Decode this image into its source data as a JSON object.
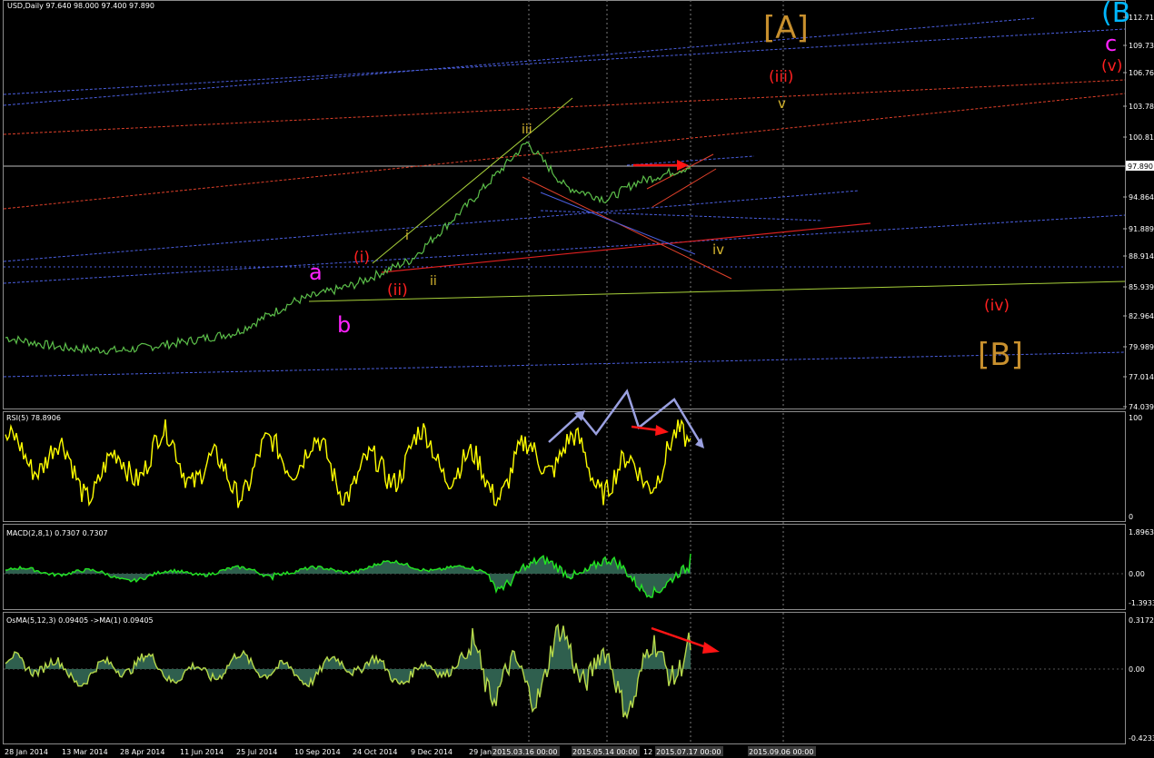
{
  "symbol_header": "USD,Daily  97.640 98.000 97.400 97.890",
  "colors": {
    "background": "#000000",
    "price_line": "#5cbf4a",
    "rsi_line": "#ffff00",
    "macd_line": "#22e622",
    "macd_fill": "#2f5f4e",
    "osma_line": "#b6d94a",
    "osma_fill": "#2f5f4e",
    "red_arrow": "#ff1414",
    "grey_arrow": "#9aa0e0"
  },
  "price_axis": {
    "ticks": [
      "112.71",
      "109.73",
      "106.76",
      "103.78",
      "100.81",
      "97.890",
      "94.864",
      "91.889",
      "88.914",
      "85.939",
      "82.964",
      "79.989",
      "77.014",
      "74.039"
    ],
    "current_price_label": "97.890"
  },
  "rsi_panel": {
    "label": "RSI(5) 78.8906",
    "ticks": [
      "100",
      "0"
    ]
  },
  "macd_panel": {
    "label": "MACD(2,8,1) 0.7307 0.7307",
    "ticks": [
      "1.8963",
      "0.00",
      "-1.3933"
    ]
  },
  "osma_panel": {
    "label": "OsMA(5,12,3) 0.09405  ->MA(1) 0.09405",
    "ticks": [
      "0.3172",
      "0.00",
      "-0.4233"
    ]
  },
  "date_axis": {
    "ticks": [
      "28 Jan 2014",
      "13 Mar 2014",
      "28 Apr 2014",
      "11 Jun 2014",
      "25 Jul 2014",
      "10 Sep 2014",
      "24 Oct 2014",
      "9 Dec 2014",
      "29 Jan"
    ],
    "highlighted": [
      "2015.03.16 00:00",
      "2015.05.14 00:00",
      "2015.07.17 00:00",
      "2015.09.06 00:00"
    ],
    "extra_ticks": [
      "12"
    ]
  },
  "wave_labels": [
    {
      "text": "[A]",
      "color": "#c8902e"
    },
    {
      "text": "[B]",
      "color": "#c8902e"
    },
    {
      "text": "(B",
      "color": "#00b7ff"
    },
    {
      "text": "c",
      "color": "#ff22ff"
    },
    {
      "text": "(v)",
      "color": "#ff2020"
    },
    {
      "text": "(iii)",
      "color": "#ff2020"
    },
    {
      "text": "v",
      "color": "#d8b830"
    },
    {
      "text": "iii",
      "color": "#d8b830"
    },
    {
      "text": "iv",
      "color": "#d8b830"
    },
    {
      "text": "i",
      "color": "#d8b830"
    },
    {
      "text": "ii",
      "color": "#d8b830"
    },
    {
      "text": "(i)",
      "color": "#ff2020"
    },
    {
      "text": "(ii)",
      "color": "#ff2020"
    },
    {
      "text": "(iv)",
      "color": "#ff2020"
    },
    {
      "text": "a",
      "color": "#ff22ff"
    },
    {
      "text": "b",
      "color": "#ff22ff"
    }
  ],
  "chart_data": [
    {
      "type": "line",
      "title": "USD,Daily",
      "y_range": [
        74.039,
        112.71
      ],
      "x_range": [
        "28 Jan 2014",
        "2015.09.06"
      ],
      "series": [
        {
          "name": "USD,Daily",
          "dates": [
            "28 Jan 2014",
            "13 Mar 2014",
            "28 Apr 2014",
            "11 Jun 2014",
            "25 Jul 2014",
            "10 Sep 2014",
            "24 Oct 2014",
            "9 Dec 2014",
            "29 Jan 2015",
            "2015.03.16",
            "2015.04.13",
            "2015.05.14",
            "2015.06.08",
            "2015.07.17"
          ],
          "values": [
            80.9,
            79.9,
            79.6,
            80.4,
            81.4,
            84.5,
            86.1,
            88.6,
            94.2,
            100.3,
            95.9,
            94.6,
            96.3,
            97.89
          ]
        }
      ],
      "grid": false
    },
    {
      "type": "line",
      "title": "RSI(5) 78.8906",
      "y_range": [
        0,
        100
      ],
      "series": [
        {
          "name": "RSI(5)",
          "values": [
            78.8906
          ]
        }
      ]
    },
    {
      "type": "area",
      "title": "MACD(2,8,1) 0.7307 0.7307",
      "y_range": [
        -1.3933,
        1.8963
      ],
      "series": [
        {
          "name": "MACD(2,8,1)",
          "values": [
            0.7307
          ]
        }
      ]
    },
    {
      "type": "area",
      "title": "OsMA(5,12,3) 0.09405 ->MA(1) 0.09405",
      "y_range": [
        -0.4233,
        0.3172
      ],
      "series": [
        {
          "name": "OsMA(5,12,3)",
          "values": [
            0.09405
          ]
        }
      ]
    }
  ]
}
